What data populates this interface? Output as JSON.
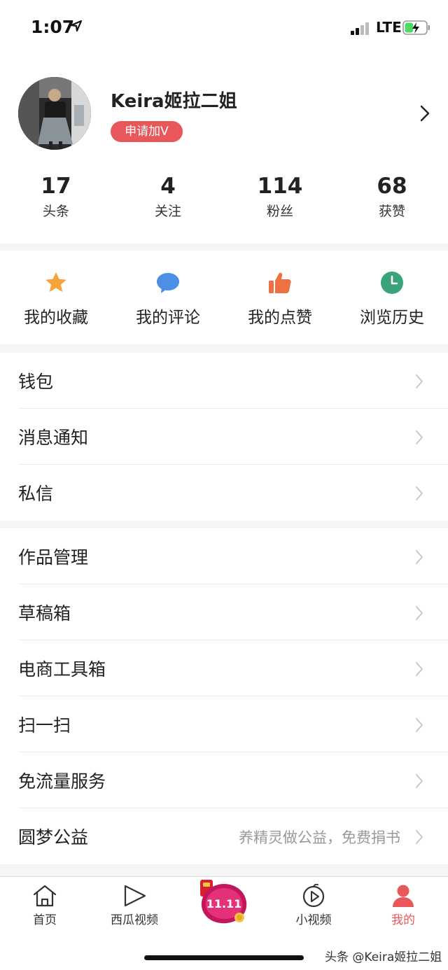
{
  "status_bar": {
    "time": "1:07",
    "network": "LTE",
    "icons": [
      "location-arrow-icon",
      "signal-icon",
      "battery-charging-icon"
    ],
    "battery_level": 0.4
  },
  "profile": {
    "name": "Keira姬拉二姐",
    "verify_label": "申请加V",
    "stats": [
      {
        "value": "17",
        "label": "头条"
      },
      {
        "value": "4",
        "label": "关注"
      },
      {
        "value": "114",
        "label": "粉丝"
      },
      {
        "value": "68",
        "label": "获赞"
      }
    ]
  },
  "quick_actions": [
    {
      "label": "我的收藏",
      "icon": "star-icon",
      "color": "#f5a33d"
    },
    {
      "label": "我的评论",
      "icon": "comment-icon",
      "color": "#4d8fe5"
    },
    {
      "label": "我的点赞",
      "icon": "thumbs-up-icon",
      "color": "#ef7042"
    },
    {
      "label": "浏览历史",
      "icon": "clock-icon",
      "color": "#3aa37a"
    }
  ],
  "menu_group_1": [
    {
      "label": "钱包"
    },
    {
      "label": "消息通知"
    },
    {
      "label": "私信"
    }
  ],
  "menu_group_2": [
    {
      "label": "作品管理"
    },
    {
      "label": "草稿箱"
    },
    {
      "label": "电商工具箱"
    },
    {
      "label": "扫一扫"
    },
    {
      "label": "免流量服务"
    },
    {
      "label": "圆梦公益",
      "hint": "养精灵做公益，免费捐书"
    }
  ],
  "tab_bar": {
    "tabs": [
      {
        "label": "首页",
        "icon": "home-icon"
      },
      {
        "label": "西瓜视频",
        "icon": "play-icon"
      },
      {
        "label": "小视频",
        "icon": "short-video-icon"
      },
      {
        "label": "我的",
        "icon": "person-icon"
      }
    ],
    "active_color": "#e8585a",
    "watermark": "头条 @Keira姬拉二姐"
  }
}
